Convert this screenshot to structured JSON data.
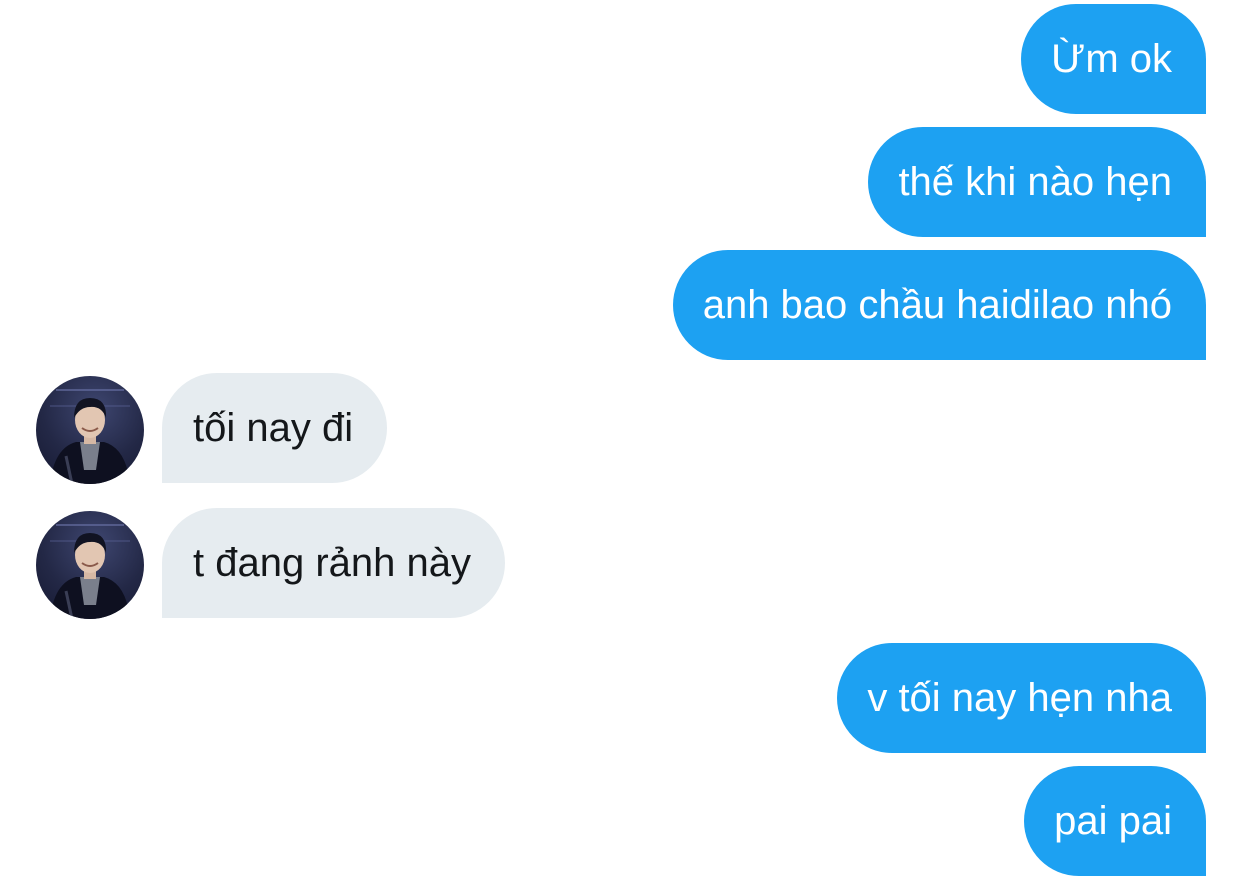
{
  "conversation": {
    "messages": [
      {
        "sender": "me",
        "text": "Ừm ok"
      },
      {
        "sender": "me",
        "text": "thế khi nào hẹn"
      },
      {
        "sender": "me",
        "text": "anh bao chầu haidilao nhó"
      },
      {
        "sender": "other",
        "text": "tối nay đi",
        "avatar_icon": "avatar-photo"
      },
      {
        "sender": "other",
        "text": "t đang rảnh này",
        "avatar_icon": "avatar-photo"
      },
      {
        "sender": "me",
        "text": "v tối nay hẹn nha"
      },
      {
        "sender": "me",
        "text": "pai pai"
      }
    ]
  },
  "colors": {
    "sent_bubble": "#1da1f2",
    "received_bubble": "#e6ecf0",
    "sent_text": "#ffffff",
    "received_text": "#14171a"
  }
}
